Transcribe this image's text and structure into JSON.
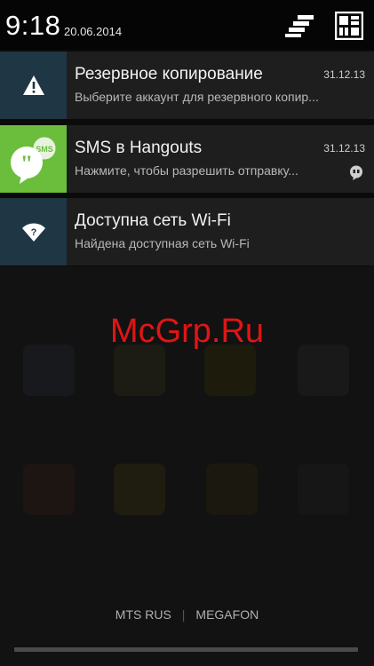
{
  "status": {
    "time": "9:18",
    "date": "20.06.2014"
  },
  "header": {
    "settings_icon": "quick-settings-icon",
    "user_icon": "user-grid-icon"
  },
  "notifications": [
    {
      "icon": "warning-icon",
      "title": "Резервное копирование",
      "text": "Выберите аккаунт для резервного копир...",
      "time": "31.12.13"
    },
    {
      "icon": "hangouts-icon",
      "title": "SMS в Hangouts",
      "text": "Нажмите, чтобы разрешить отправку...",
      "time": "31.12.13",
      "badge_icon": "hangouts-small-icon"
    },
    {
      "icon": "wifi-question-icon",
      "title": "Доступна сеть Wi-Fi",
      "text": "Найдена доступная сеть Wi-Fi",
      "time": ""
    }
  ],
  "watermark": "McGrp.Ru",
  "carrier": {
    "sim1": "MTS RUS",
    "separator": "|",
    "sim2": "MEGAFON"
  },
  "colors": {
    "header_bg": "#050505",
    "notif_bg": "#1e1e1e",
    "icon_blue": "#1f3644",
    "hangouts_green": "#6abe3c",
    "watermark": "#e01515"
  }
}
